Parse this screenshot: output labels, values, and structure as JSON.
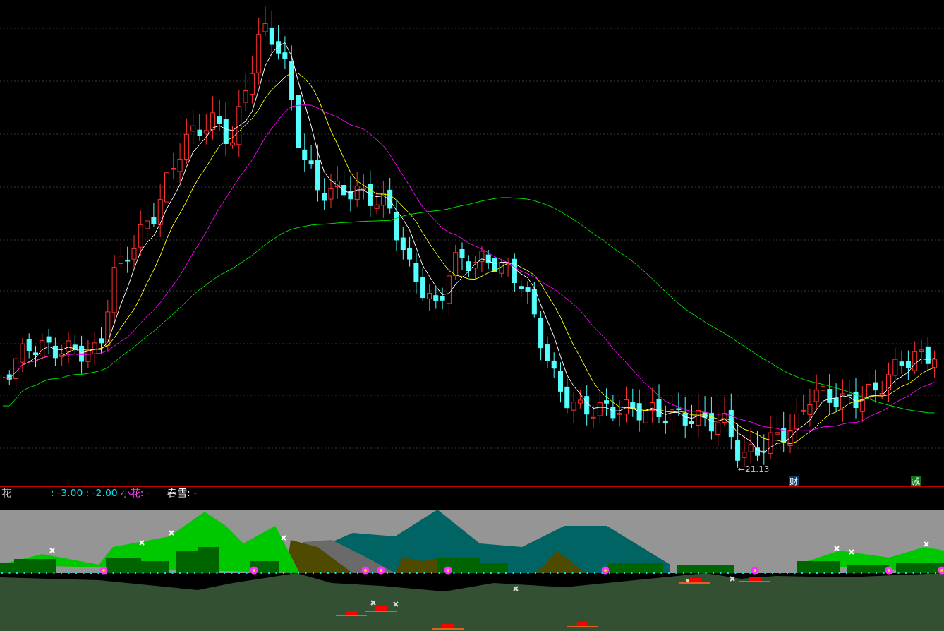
{
  "main_chart": {
    "price_label": "←21.13",
    "signals": [
      {
        "text": "财",
        "color": "#0b3a6a"
      },
      {
        "text": "减",
        "color": "#0a7a10"
      }
    ]
  },
  "indicator": {
    "legend": [
      {
        "text": "花",
        "color": "#c0c0c0"
      },
      {
        "text": ": -3.00",
        "color": "#00e0e8"
      },
      {
        "text": ": -2.00",
        "color": "#00e0e8"
      },
      {
        "text": "小花: -",
        "color": "#ff40ff"
      },
      {
        "text": "春雪: -",
        "color": "#ffffff"
      }
    ]
  }
}
